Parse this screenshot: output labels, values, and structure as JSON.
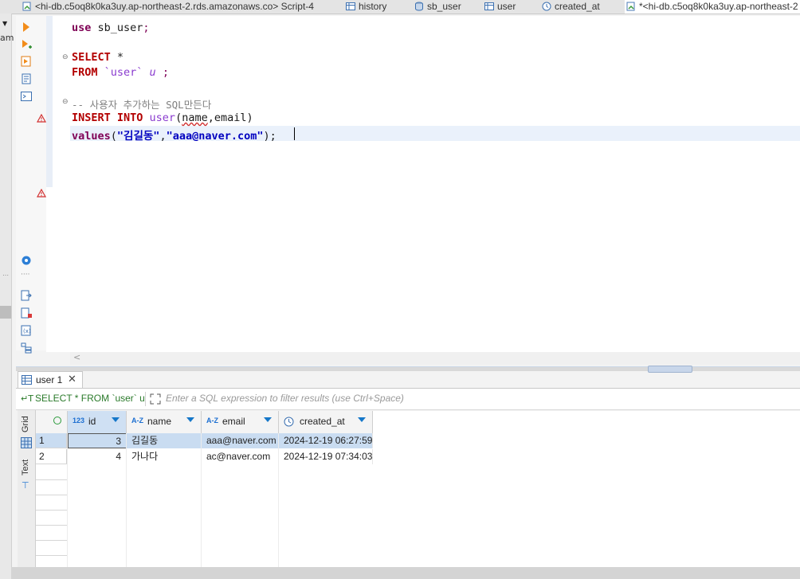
{
  "tabs": [
    {
      "label": "<hi-db.c5oq8k0ka3uy.ap-northeast-2.rds.amazonaws.co> Script-4",
      "icon": "sql-script-icon",
      "active": false
    },
    {
      "label": "history",
      "icon": "table-icon",
      "active": false
    },
    {
      "label": "sb_user",
      "icon": "database-icon",
      "active": false
    },
    {
      "label": "user",
      "icon": "table-icon",
      "active": false
    },
    {
      "label": "created_at",
      "icon": "clock-icon",
      "active": false
    },
    {
      "label": "*<hi-db.c5oq8k0ka3uy.ap-northeast-2",
      "icon": "sql-script-icon",
      "active": true
    }
  ],
  "left_strip": {
    "cut_text": "am"
  },
  "editor": {
    "lines": {
      "l1_kw": "use",
      "l1_rest": " sb_user",
      "l1_semi": ";",
      "l2_kw": "SELECT",
      "l2_rest": " *",
      "l3_kw": "FROM",
      "l3_table": " `user`",
      "l3_alias": " u",
      "l3_semi": " ;",
      "l4_comment": "-- 사용자 추가하는 SQL만든다",
      "l5_kw1": "INSERT",
      "l5_kw2": " INTO",
      "l5_table": " user",
      "l5_open": "(",
      "l5_col1": "name",
      "l5_comma": ",",
      "l5_col2": "email",
      "l5_close": ")",
      "l6_kw": "values",
      "l6_open": "(",
      "l6_str1": "\"김길동\"",
      "l6_comma": ",",
      "l6_str2": "\"aaa@naver.com\"",
      "l6_close": ");"
    }
  },
  "results": {
    "tab_label": "user 1",
    "filter_sql": "SELECT * FROM `user` u",
    "filter_placeholder": "Enter a SQL expression to filter results (use Ctrl+Space)",
    "view_tabs": {
      "grid": "Grid",
      "text": "Text"
    },
    "columns": [
      {
        "name": "id",
        "type_icon": "123"
      },
      {
        "name": "name",
        "type_icon": "A-Z"
      },
      {
        "name": "email",
        "type_icon": "A-Z"
      },
      {
        "name": "created_at",
        "type_icon": "clock"
      }
    ],
    "rows": [
      {
        "num": "1",
        "id": "3",
        "name": "김길동",
        "email": "aaa@naver.com",
        "created_at": "2024-12-19 06:27:59"
      },
      {
        "num": "2",
        "id": "4",
        "name": "가나다",
        "email": "ac@naver.com",
        "created_at": "2024-12-19 07:34:03"
      }
    ]
  },
  "colors": {
    "accent": "#1577c9",
    "keyword": "#7f0055",
    "string": "#0000c0",
    "selection": "#c9dcf1"
  }
}
